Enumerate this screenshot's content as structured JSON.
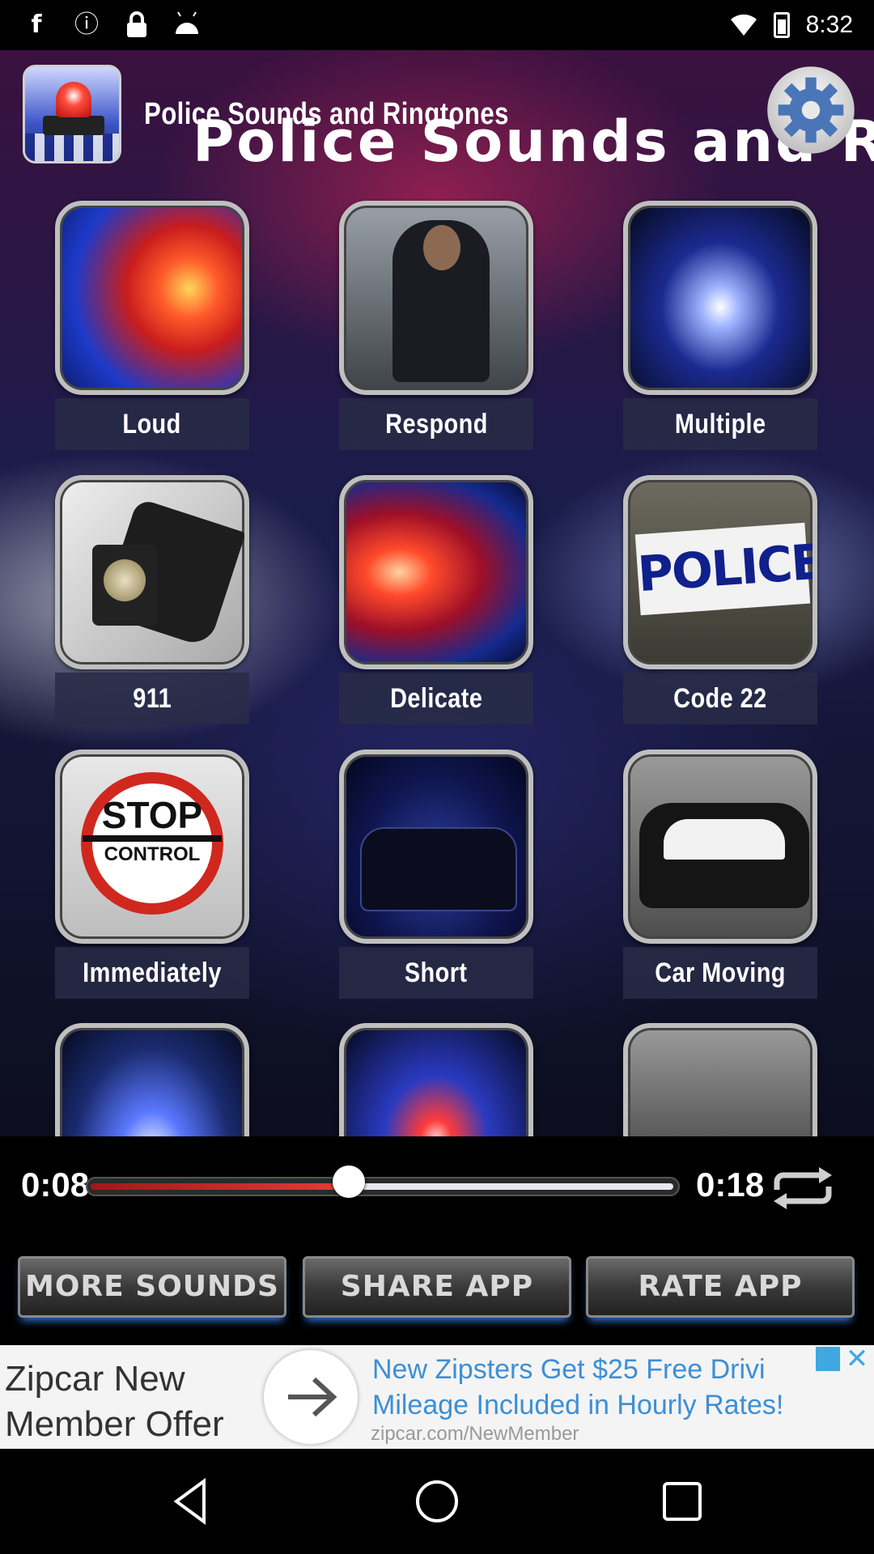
{
  "status_bar": {
    "time": "8:32",
    "left_icons": [
      "facebook-icon",
      "alert-icon",
      "lock-icon",
      "android-icon"
    ]
  },
  "header": {
    "title_small": "Police Sounds and Ringtones",
    "title_large": "Police Sounds and Ringto"
  },
  "grid": [
    {
      "label": "Loud"
    },
    {
      "label": "Respond"
    },
    {
      "label": "Multiple"
    },
    {
      "label": "911"
    },
    {
      "label": "Delicate"
    },
    {
      "label": "Code 22"
    },
    {
      "label": "Immediately"
    },
    {
      "label": "Short"
    },
    {
      "label": "Car Moving"
    }
  ],
  "thumb_text": {
    "police_sign": "POLICE",
    "stop": "STOP",
    "control": "CONTROL"
  },
  "player": {
    "current_time": "0:08",
    "total_time": "0:18",
    "progress": 0.44
  },
  "buttons": {
    "more_sounds": "MORE SOUNDS",
    "share_app": "SHARE APP",
    "rate_app": "RATE APP"
  },
  "ad": {
    "left_text": "Zipcar New Member Offer",
    "right_text_line1": "New Zipsters Get $25 Free Drivi",
    "right_text_line2": "Mileage Included in Hourly Rates!",
    "url": "zipcar.com/NewMember"
  },
  "colors": {
    "accent_blue": "#3d8fd6",
    "progress_red": "#e83a3a"
  }
}
